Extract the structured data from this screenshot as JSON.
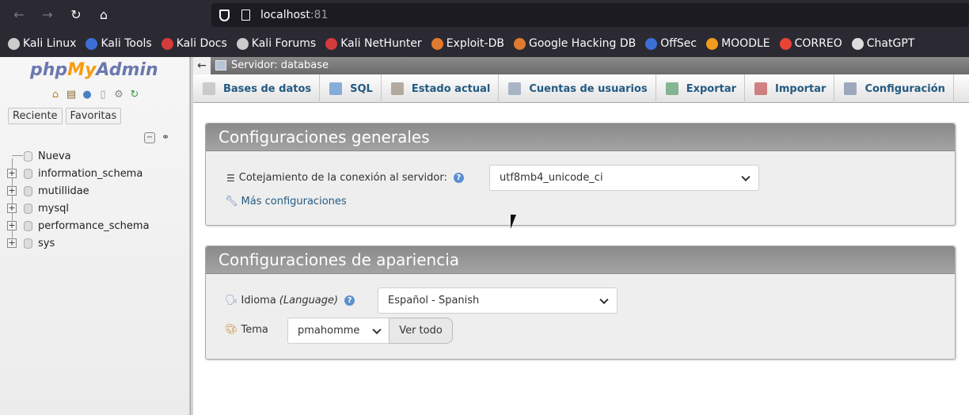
{
  "browser": {
    "url_host": "localhost",
    "url_port": ":81",
    "bookmarks": [
      {
        "label": "Kali Linux",
        "color": "#cccccc"
      },
      {
        "label": "Kali Tools",
        "color": "#3d6fd6"
      },
      {
        "label": "Kali Docs",
        "color": "#d63b3b"
      },
      {
        "label": "Kali Forums",
        "color": "#cccccc"
      },
      {
        "label": "Kali NetHunter",
        "color": "#d63b3b"
      },
      {
        "label": "Exploit-DB",
        "color": "#e07a2e"
      },
      {
        "label": "Google Hacking DB",
        "color": "#e07a2e"
      },
      {
        "label": "OffSec",
        "color": "#3d6fd6"
      },
      {
        "label": "MOODLE",
        "color": "#f29a1e"
      },
      {
        "label": "CORREO",
        "color": "#ea4335"
      },
      {
        "label": "ChatGPT",
        "color": "#dddddd"
      }
    ]
  },
  "sidebar": {
    "logo": {
      "php": "php",
      "my": "My",
      "admin": "Admin"
    },
    "tabs": [
      "Reciente",
      "Favoritas"
    ],
    "tree": [
      {
        "label": "Nueva",
        "expandable": false
      },
      {
        "label": "information_schema",
        "expandable": true
      },
      {
        "label": "mutillidae",
        "expandable": true
      },
      {
        "label": "mysql",
        "expandable": true
      },
      {
        "label": "performance_schema",
        "expandable": true
      },
      {
        "label": "sys",
        "expandable": true
      }
    ]
  },
  "header": {
    "breadcrumb": "Servidor: database"
  },
  "tabs": [
    {
      "label": "Bases de datos",
      "icon": "database-icon"
    },
    {
      "label": "SQL",
      "icon": "sql-icon"
    },
    {
      "label": "Estado actual",
      "icon": "status-icon"
    },
    {
      "label": "Cuentas de usuarios",
      "icon": "users-icon"
    },
    {
      "label": "Exportar",
      "icon": "export-icon"
    },
    {
      "label": "Importar",
      "icon": "import-icon"
    },
    {
      "label": "Configuración",
      "icon": "wrench-icon"
    }
  ],
  "general": {
    "title": "Configuraciones generales",
    "collation_label": "Cotejamiento de la conexión al servidor:",
    "collation_value": "utf8mb4_unicode_ci",
    "more_settings": "Más configuraciones"
  },
  "appearance": {
    "title": "Configuraciones de apariencia",
    "language_label": "Idioma",
    "language_hint": "(Language)",
    "language_value": "Español - Spanish",
    "theme_label": "Tema",
    "theme_value": "pmahomme",
    "view_all": "Ver todo"
  }
}
